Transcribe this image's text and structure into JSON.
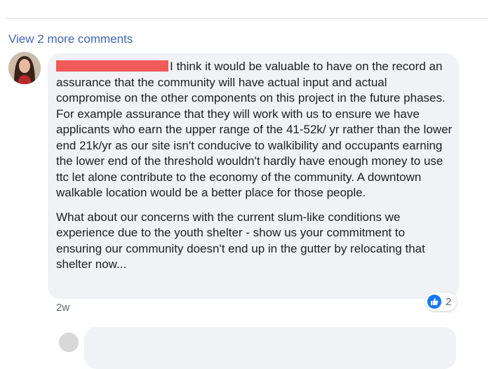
{
  "thread": {
    "view_more_label": "View 2 more comments"
  },
  "comment": {
    "paragraph_1": "I think it would be valuable to have on the record an assurance that the community will have actual input and actual compromise on the other components on this project in the future phases. For example assurance that they will work with us to ensure we have applicants who earn the upper range of the 41-52k/ yr rather than the lower end 21k/yr as our site isn't conducive to walkibility and occupants earning the lower end of the threshold wouldn't hardly have enough money to use ttc let alone contribute to the economy of the community. A downtown walkable location would be a better place for those people.",
    "paragraph_2": "What about our concerns with the current slum-like conditions we experience due to the youth shelter - show us your commitment to ensuring our community doesn't end up in the gutter by relocating that shelter now...",
    "timestamp": "2w",
    "reaction_count": "2",
    "reaction_icon": "like-icon",
    "author_redaction_color": "#f25a5a"
  },
  "colors": {
    "link": "#4267b2",
    "bubble": "#f0f2f5",
    "like": "#1877f2",
    "meta": "#65676b"
  }
}
